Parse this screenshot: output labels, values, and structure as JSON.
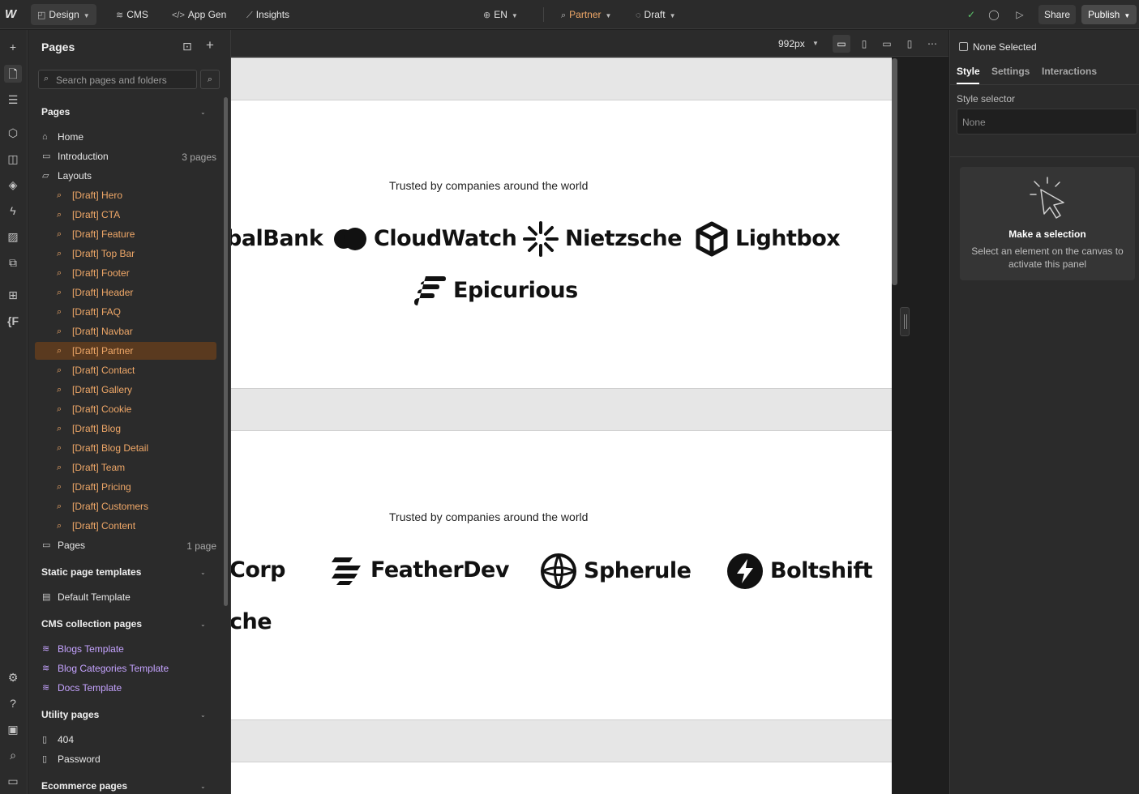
{
  "topbar": {
    "design": "Design",
    "cms": "CMS",
    "app_gen": "App Gen",
    "insights": "Insights",
    "locale": "EN",
    "page": "Partner",
    "status": "Draft",
    "share": "Share",
    "publish": "Publish"
  },
  "pages_panel": {
    "title": "Pages",
    "search_placeholder": "Search pages and folders",
    "sections": {
      "pages": "Pages",
      "static": "Static page templates",
      "cms": "CMS collection pages",
      "utility": "Utility pages",
      "ecommerce": "Ecommerce pages"
    },
    "home": "Home",
    "introduction": {
      "label": "Introduction",
      "meta": "3 pages"
    },
    "layouts": "Layouts",
    "drafts": [
      "[Draft] Hero",
      "[Draft] CTA",
      "[Draft] Feature",
      "[Draft] Top Bar",
      "[Draft] Footer",
      "[Draft] Header",
      "[Draft] FAQ",
      "[Draft] Navbar",
      "[Draft] Partner",
      "[Draft] Contact",
      "[Draft] Gallery",
      "[Draft] Cookie",
      "[Draft] Blog",
      "[Draft] Blog Detail",
      "[Draft] Team",
      "[Draft] Pricing",
      "[Draft] Customers",
      "[Draft] Content"
    ],
    "pages_folder": {
      "label": "Pages",
      "meta": "1 page"
    },
    "default_template": "Default Template",
    "cms_pages": [
      "Blogs Template",
      "Blog Categories Template",
      "Docs Template"
    ],
    "utility": [
      "404",
      "Password"
    ]
  },
  "canvas": {
    "breakpoint": "992px",
    "section1": {
      "heading": "Trusted by companies around the world",
      "logos": [
        "balBank",
        "CloudWatch",
        "Nietzsche",
        "Lightbox",
        "Epicurious"
      ]
    },
    "section2": {
      "heading": "Trusted by companies around the world",
      "logos": [
        "Corp",
        "FeatherDev",
        "Spherule",
        "Boltshift",
        "che"
      ]
    }
  },
  "right_panel": {
    "none_selected": "None Selected",
    "tabs": [
      "Style",
      "Settings",
      "Interactions"
    ],
    "style_selector": "Style selector",
    "style_value": "None",
    "card_title": "Make a selection",
    "card_desc": "Select an element on the canvas to activate this panel"
  },
  "colors": {
    "accent_orange": "#f0a868",
    "cms_purple": "#c5a3ff",
    "selected_row": "#5a3a1f"
  }
}
